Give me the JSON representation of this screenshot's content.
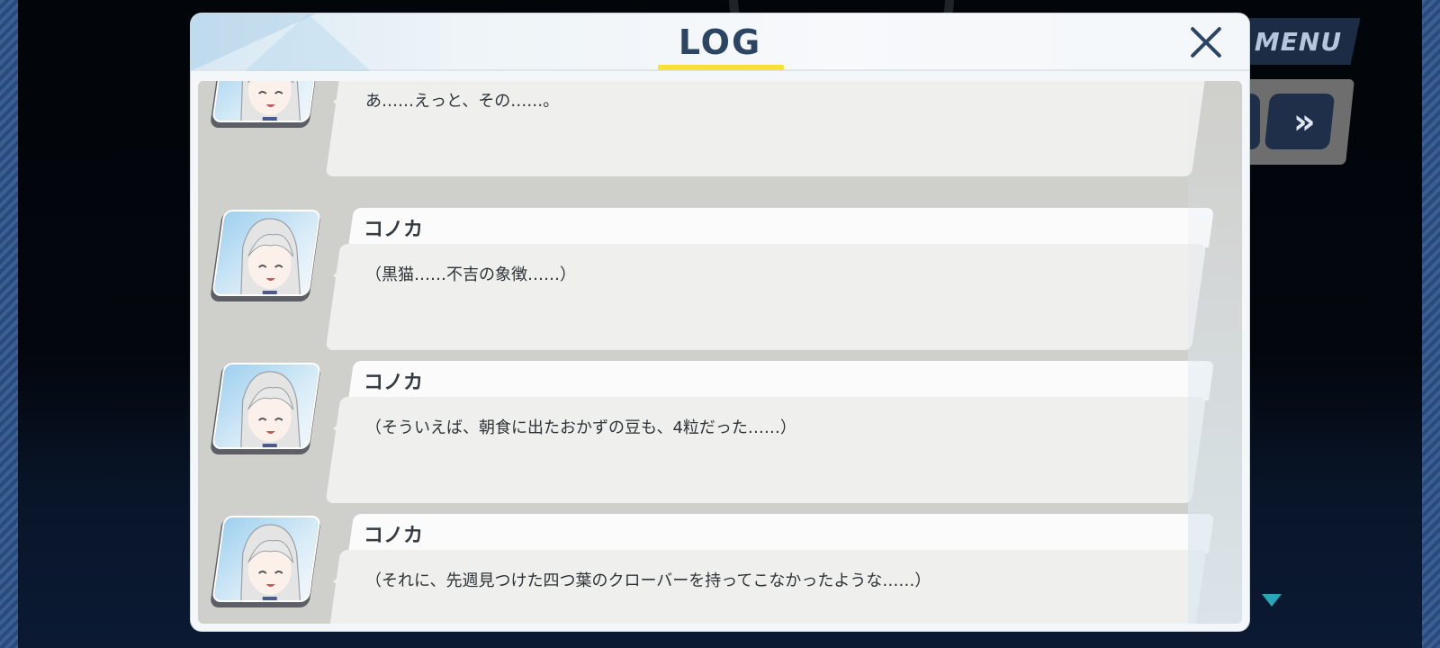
{
  "window": {
    "menu_label": "MENU",
    "fast_forward_icon": "»"
  },
  "dialog": {
    "title": "LOG",
    "close_icon": "close-icon",
    "entries": [
      {
        "speaker": "",
        "text": "あ……えっと、その……。"
      },
      {
        "speaker": "コノカ",
        "text": "（黒猫……不吉の象徴……）"
      },
      {
        "speaker": "コノカ",
        "text": "（そういえば、朝食に出たおかずの豆も、4粒だった……）"
      },
      {
        "speaker": "コノカ",
        "text": "（それに、先週見つけた四つ葉のクローバーを持ってこなかったような……）"
      }
    ]
  },
  "colors": {
    "title": "#2c4562",
    "title_underline": "#f5e13a",
    "menu_bg": "#1c2c44",
    "scroll_indicator": "#2aa5b8"
  }
}
